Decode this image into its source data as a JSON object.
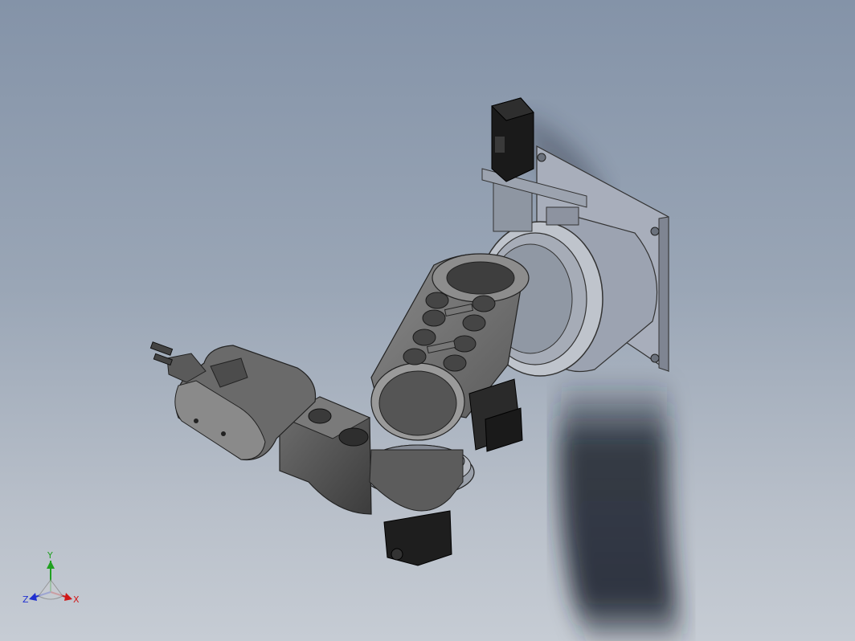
{
  "viewport": {
    "background_top": "#8493a8",
    "background_bottom": "#c6ccd4",
    "model_description_icon": "robot-arm-model"
  },
  "triad": {
    "x_label": "X",
    "y_label": "Y",
    "z_label": "Z",
    "x_color": "#d01818",
    "y_color": "#20a020",
    "z_color": "#2030d0"
  }
}
